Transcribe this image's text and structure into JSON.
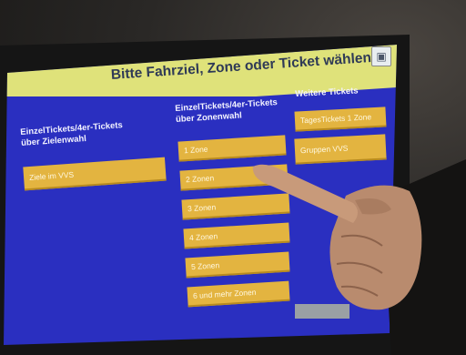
{
  "screen": {
    "title": "Bitte Fahrziel, Zone oder Ticket wählen",
    "corner_icon": "ticket-icon",
    "columns": [
      {
        "heading_line1": "EinzelTickets/4er-Tickets",
        "heading_line2": "über Zielenwahl",
        "buttons": [
          "Ziele im VVS"
        ]
      },
      {
        "heading_line1": "EinzelTickets/4er-Tickets",
        "heading_line2": "über Zonenwahl",
        "buttons": [
          "1 Zone",
          "2 Zonen",
          "3 Zonen",
          "4 Zonen",
          "5 Zonen",
          "6 und mehr Zonen"
        ]
      },
      {
        "heading_line1": "Weitere Tickets",
        "heading_line2": "",
        "buttons": [
          "TagesTickets 1 Zone",
          "Gruppen VVS"
        ]
      }
    ]
  },
  "colors": {
    "screen_blue": "#2a2fc0",
    "title_bar": "#dfe27a",
    "button": "#e3b440"
  }
}
